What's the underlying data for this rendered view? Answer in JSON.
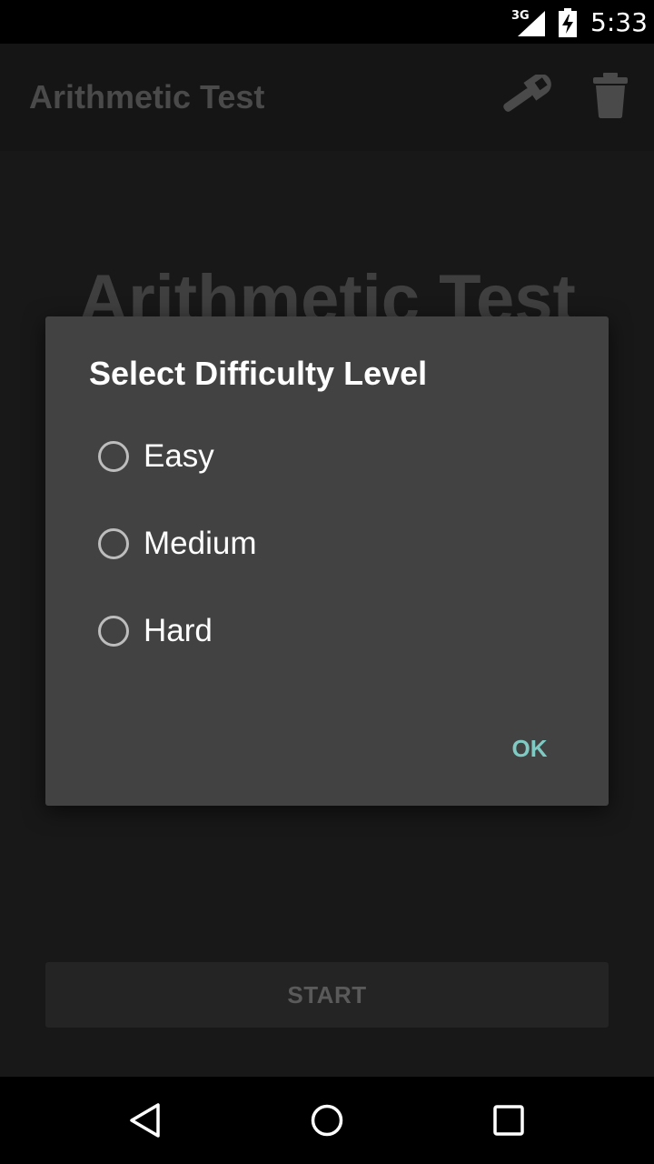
{
  "status_bar": {
    "network": "3G",
    "time": "5:33",
    "icons": [
      "signal-icon",
      "battery-charging-icon"
    ]
  },
  "app_bar": {
    "title": "Arithmetic Test",
    "actions": [
      "wrench-icon",
      "trash-icon"
    ]
  },
  "main": {
    "heading": "Arithmetic Test",
    "start_label": "START"
  },
  "dialog": {
    "title": "Select Difficulty Level",
    "options": [
      {
        "label": "Easy",
        "selected": false
      },
      {
        "label": "Medium",
        "selected": false
      },
      {
        "label": "Hard",
        "selected": false
      }
    ],
    "ok_label": "OK"
  },
  "nav_bar": {
    "buttons": [
      "back-icon",
      "home-icon",
      "recents-icon"
    ]
  },
  "colors": {
    "accent": "#7fcbc4",
    "dialog_bg": "#424242",
    "status_bar": "#000000"
  }
}
